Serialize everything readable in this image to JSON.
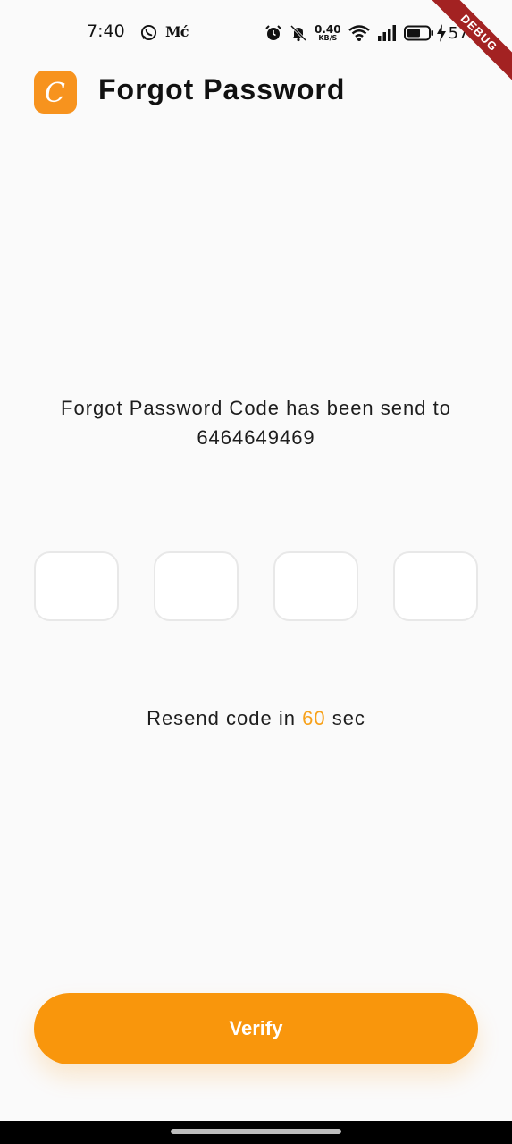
{
  "status_bar": {
    "time": "7:40",
    "app_indicator": "Mć",
    "net_speed_value": "0.40",
    "net_speed_unit": "KB/S",
    "battery_percent": "57%",
    "icons": [
      "whatsapp-icon",
      "alarm-icon",
      "bell-muted-icon",
      "wifi-icon",
      "signal-icon",
      "battery-icon",
      "charging-bolt-icon"
    ]
  },
  "debug_ribbon": "DEBUG",
  "header": {
    "logo_letter": "C",
    "title": "Forgot Password"
  },
  "message": {
    "line1": "Forgot Password Code has been send to",
    "phone": "6464649469"
  },
  "otp": {
    "digits": [
      "",
      "",
      "",
      ""
    ]
  },
  "resend": {
    "prefix": "Resend code in",
    "seconds": "60",
    "suffix": "sec"
  },
  "verify_button": "Verify",
  "colors": {
    "accent": "#f9960c",
    "countdown": "#f7a11a",
    "background": "#fafafa"
  }
}
